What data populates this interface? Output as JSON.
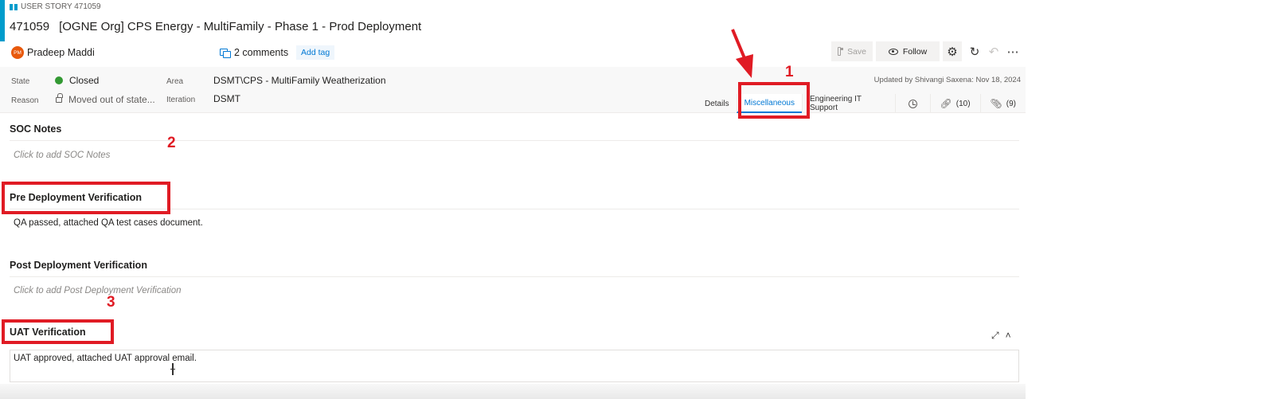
{
  "workitem": {
    "type_label": "USER STORY 471059",
    "id": "471059",
    "title": "[OGNE Org] CPS Energy - MultiFamily - Phase 1 - Prod Deployment",
    "assignee_initials": "PM",
    "assignee_name": "Pradeep Maddi",
    "comments_label": "2 comments",
    "add_tag_label": "Add tag"
  },
  "toolbar": {
    "save_label": "Save",
    "follow_label": "Follow",
    "icons": [
      "gear-icon",
      "refresh-icon",
      "undo-icon",
      "more-icon"
    ]
  },
  "fields": {
    "state_label": "State",
    "state_value": "Closed",
    "state_color": "#339933",
    "reason_label": "Reason",
    "reason_value": "Moved out of state...",
    "area_label": "Area",
    "area_value": "DSMT\\CPS - MultiFamily Weatherization",
    "iteration_label": "Iteration",
    "iteration_value": "DSMT",
    "updated_text": "Updated by Shivangi Saxena: Nov 18, 2024"
  },
  "tabs": [
    {
      "label": "Details"
    },
    {
      "label": "Miscellaneous",
      "active": true
    },
    {
      "label": "Engineering IT Support"
    },
    {
      "label": "(10)",
      "icon": "link-icon"
    },
    {
      "label": "(9)",
      "icon": "attachment-icon"
    }
  ],
  "sections": {
    "soc_title": "SOC Notes",
    "soc_placeholder": "Click to add SOC Notes",
    "pre_title": "Pre Deployment Verification",
    "pre_text": "QA passed, attached QA test cases document.",
    "post_title": "Post Deployment Verification",
    "post_placeholder": "Click to add Post Deployment Verification",
    "uat_title": "UAT Verification",
    "uat_text": "UAT approved, attached UAT approval email."
  },
  "annotations": {
    "num1": "1",
    "num2": "2",
    "num3": "3",
    "color": "#e01b24"
  },
  "colors": {
    "accent": "#0078d4",
    "story_blue": "#009ccc"
  }
}
